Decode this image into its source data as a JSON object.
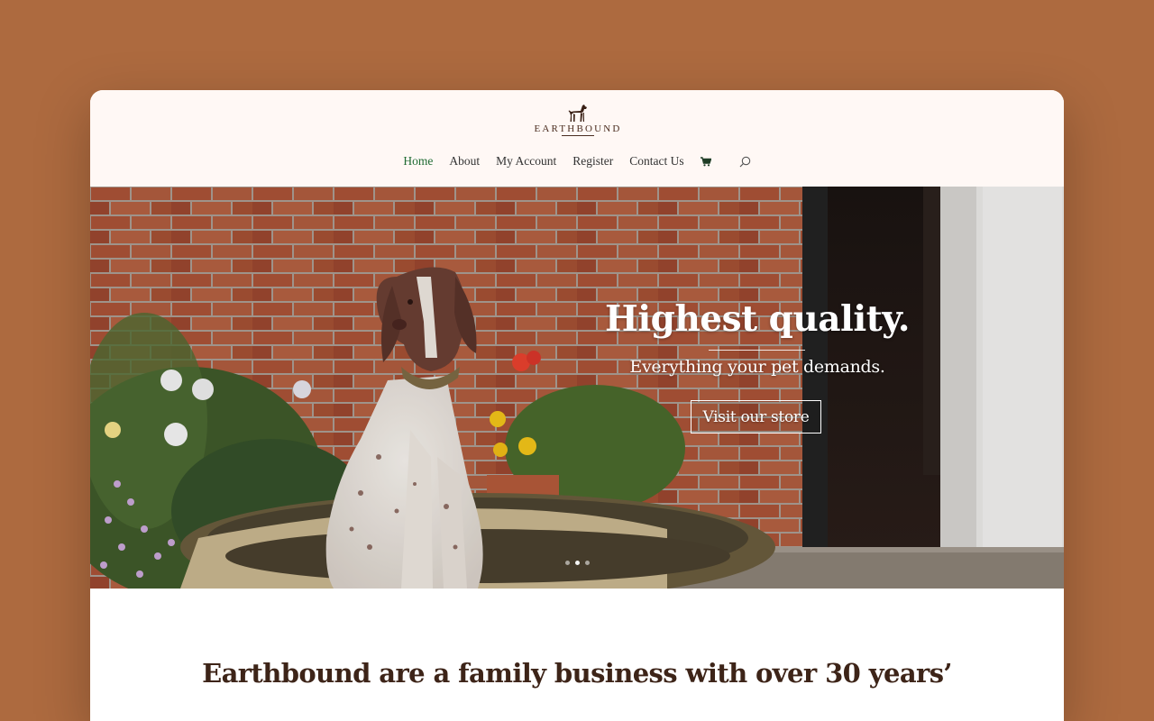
{
  "brand": {
    "name": "EARTHBOUND",
    "logo_icon": "dog-icon",
    "color": "#4a2c1f"
  },
  "nav": {
    "items": [
      {
        "label": "Home",
        "active": true
      },
      {
        "label": "About",
        "active": false
      },
      {
        "label": "My Account",
        "active": false
      },
      {
        "label": "Register",
        "active": false
      },
      {
        "label": "Contact Us",
        "active": false
      }
    ],
    "cart_icon": "cart-icon",
    "search_icon": "search-icon",
    "active_color": "#1f6b33"
  },
  "hero": {
    "title": "Highest quality.",
    "subtitle": "Everything your pet demands.",
    "button_label": "Visit our store",
    "slides": 3,
    "active_slide": 2
  },
  "intro": {
    "heading": "Earthbound are a family business with over 30 years’"
  },
  "colors": {
    "page_background": "#ad6a3f",
    "header_background": "#fff8f5"
  }
}
